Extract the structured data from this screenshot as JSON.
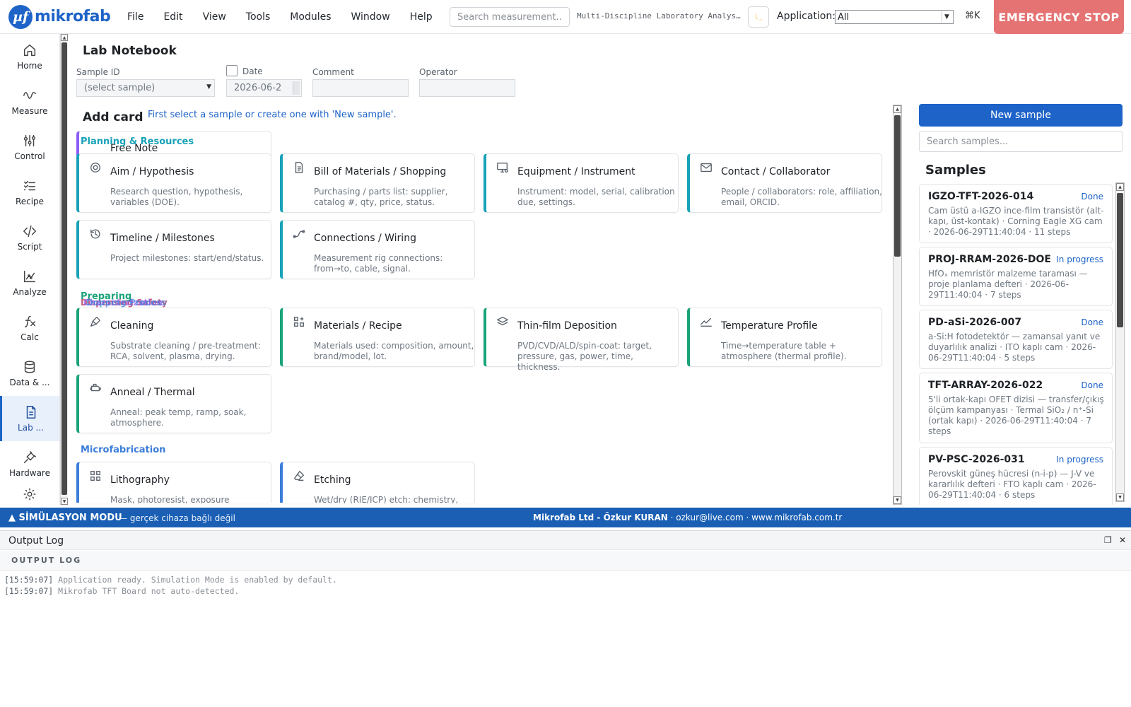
{
  "app": {
    "logo_mark": "µf",
    "logo_text": "mikrofab",
    "window_title": "Multi-Discipline Laboratory Analysis",
    "application_label": "Application:",
    "application_value": "All",
    "shortcut": "⌘K",
    "estop_label": "EMERGENCY STOP",
    "search_placeholder": "Search measurement..."
  },
  "menu": [
    "File",
    "Edit",
    "View",
    "Tools",
    "Modules",
    "Window",
    "Help"
  ],
  "sidebar": [
    {
      "label": "Home",
      "icon": "home-icon"
    },
    {
      "label": "Measure",
      "icon": "wave-icon"
    },
    {
      "label": "Control",
      "icon": "sliders-icon"
    },
    {
      "label": "Recipe",
      "icon": "checklist-icon"
    },
    {
      "label": "Script",
      "icon": "code-icon"
    },
    {
      "label": "Analyze",
      "icon": "chart-icon"
    },
    {
      "label": "Calc",
      "icon": "function-icon"
    },
    {
      "label": "Data & ...",
      "icon": "database-icon"
    },
    {
      "label": "Lab ...",
      "icon": "document-icon",
      "active": true
    },
    {
      "label": "Hardware",
      "icon": "plug-icon"
    }
  ],
  "notebook": {
    "title": "Lab Notebook",
    "sample_id_label": "Sample ID",
    "sample_id_value": "(select sample)",
    "date_label": "Date",
    "date_value": "2026-06-2",
    "comment_label": "Comment",
    "operator_label": "Operator",
    "add_card_title": "Add card",
    "add_card_hint": "First select a sample or create one with 'New sample'."
  },
  "sections": {
    "planning": "Planning & Resources",
    "preparing": "Preparing",
    "microfab": "Microfabrication"
  },
  "cards": {
    "free_note": {
      "title": "Free Note"
    },
    "aim": {
      "title": "Aim / Hypothesis",
      "desc": "Research question, hypothesis, variables (DOE)."
    },
    "bom": {
      "title": "Bill of Materials / Shopping",
      "desc": "Purchasing / parts list: supplier, catalog #, qty, price, status."
    },
    "equipment": {
      "title": "Equipment / Instrument",
      "desc": "Instrument: model, serial, calibration due, settings."
    },
    "contact": {
      "title": "Contact / Collaborator",
      "desc": "People / collaborators: role, affiliation, email, ORCID."
    },
    "timeline": {
      "title": "Timeline / Milestones",
      "desc": "Project milestones: start/end/status."
    },
    "connections": {
      "title": "Connections / Wiring",
      "desc": "Measurement rig connections: from→to, cable, signal."
    },
    "cleaning": {
      "title": "Cleaning",
      "desc": "Substrate cleaning / pre-treatment: RCA, solvent, plasma, drying."
    },
    "materials": {
      "title": "Materials / Recipe",
      "desc": "Materials used: composition, amount, brand/model, lot."
    },
    "thinfilm": {
      "title": "Thin-film Deposition",
      "desc": "PVD/CVD/ALD/spin-coat: target, pressure, gas, power, time, thickness."
    },
    "temperature": {
      "title": "Temperature Profile",
      "desc": "Time→temperature table + atmosphere (thermal profile)."
    },
    "anneal": {
      "title": "Anneal / Thermal",
      "desc": "Anneal: peak temp, ramp, soak, atmosphere."
    },
    "litho": {
      "title": "Lithography",
      "desc": "Mask, photoresist, exposure"
    },
    "etching": {
      "title": "Etching",
      "desc": "Wet/dry (RIE/ICP) etch: chemistry, rate,"
    }
  },
  "samples_panel": {
    "new_button": "New sample",
    "search_placeholder": "Search samples...",
    "title": "Samples",
    "items": [
      {
        "id": "IGZO-TFT-2026-014",
        "status": "Done",
        "meta": "Cam üstü a-IGZO ince-film transistör (alt-kapı, üst-kontak)  ·  Corning Eagle XG cam  ·  2026-06-29T11:40:04  ·  11 steps"
      },
      {
        "id": "PROJ-RRAM-2026-DOE",
        "status": "In progress",
        "meta": "HfOₓ memristör malzeme taraması — proje planlama defteri  ·  2026-06-29T11:40:04  ·  7 steps"
      },
      {
        "id": "PD-aSi-2026-007",
        "status": "Done",
        "meta": "a-Si:H fotodetektör — zamansal yanıt ve duyarlılık analizi  ·  ITO kaplı cam  ·  2026-06-29T11:40:04  ·  5 steps"
      },
      {
        "id": "TFT-ARRAY-2026-022",
        "status": "Done",
        "meta": "5'li ortak-kapı OFET dizisi — transfer/çıkış ölçüm kampanyası  ·  Termal SiO₂ / n⁺-Si (ortak kapı)  ·  2026-06-29T11:40:04  ·  7 steps"
      },
      {
        "id": "PV-PSC-2026-031",
        "status": "In progress",
        "meta": "Perovskit güneş hücresi (n-i-p) — J-V ve kararlılık defteri  ·  FTO kaplı cam  ·  2026-06-29T11:40:04  ·  6 steps"
      }
    ]
  },
  "status": {
    "sim_mode": "▲ SİMÜLASYON MODU",
    "sim_note": "— gerçek cihaza bağlı değil",
    "company": "Mikrofab Ltd - Özkur KURAN",
    "email": "ozkur@live.com",
    "website": "www.mikrofab.com.tr"
  },
  "output": {
    "title": "Output Log",
    "subtitle": "OUTPUT LOG",
    "lines": [
      {
        "ts": "[15:59:07]",
        "msg": " Application ready. Simulation Mode is enabled by default."
      },
      {
        "ts": "[15:59:07]",
        "msg": " Mikrofab TFT Board not auto-detected."
      }
    ]
  },
  "colors": {
    "brand": "#1e63c8",
    "estop": "#e57373",
    "status_bar": "#1a5fb4",
    "planning_accent": "#17a2b8",
    "preparing_accent": "#1aa37a",
    "microfab_accent": "#3b7dd8"
  }
}
